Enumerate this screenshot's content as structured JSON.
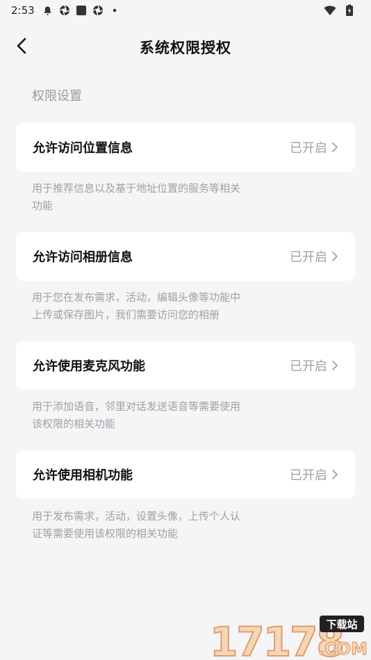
{
  "status_bar": {
    "time": "2:53",
    "left_icons": [
      "bell-icon",
      "aperture-icon",
      "square-icon",
      "aperture-icon",
      "dot-icon"
    ],
    "right_icons": [
      "wifi-icon",
      "battery-charging-icon"
    ]
  },
  "header": {
    "back_icon": "chevron-left-icon",
    "title": "系统权限授权"
  },
  "section_label": "权限设置",
  "permissions": [
    {
      "title": "允许访问位置信息",
      "status": "已开启",
      "desc_lines": [
        "用于推荐信息以及基于地址位置的服务等相关",
        "功能"
      ]
    },
    {
      "title": "允许访问相册信息",
      "status": "已开启",
      "desc_lines": [
        "用于您在发布需求，活动，编辑头像等功能中",
        "上传或保存图片，我们需要访问您的相册"
      ]
    },
    {
      "title": "允许使用麦克风功能",
      "status": "已开启",
      "desc_lines": [
        "用于添加语音，邻里对话发送语音等需要使用",
        "该权限的相关功能"
      ]
    },
    {
      "title": "允许使用相机功能",
      "status": "已开启",
      "desc_lines": [
        "用于发布需求，活动，设置头像，上传个人认",
        "证等需要使用该权限的相关功能"
      ]
    }
  ],
  "watermark": {
    "number": "17178",
    "tag": "下载站",
    "suffix": ".COM"
  },
  "colors": {
    "background": "#f5f5f7",
    "card": "#ffffff",
    "muted_text": "#a0a0a5",
    "title_text": "#111111"
  }
}
